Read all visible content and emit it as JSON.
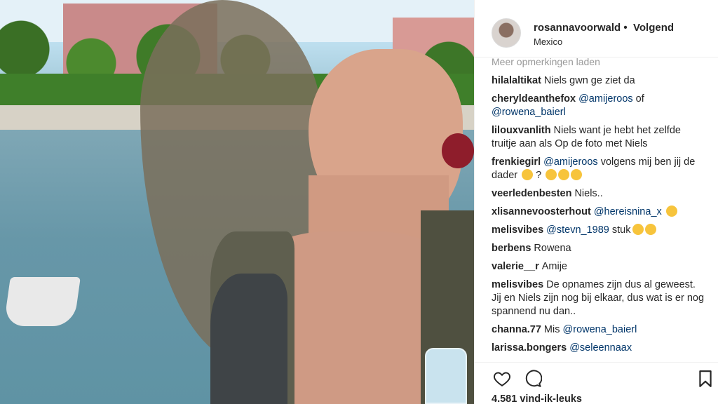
{
  "post": {
    "username": "rosannavoorwald",
    "separator": "•",
    "follow_label": "Volgend",
    "location": "Mexico"
  },
  "comments_more_label": "Meer opmerkingen laden",
  "comments": [
    {
      "user": "hilalaltikat",
      "text": "Niels gwn ge ziet da"
    },
    {
      "user": "cheryldeanthefox",
      "mention": "@amijeroos",
      "text_after": " of",
      "mention2": "@rowena_baierl"
    },
    {
      "user": "lilouxvanlith",
      "text": "Niels want je hebt het zelfde truitje aan als Op de foto met Niels"
    },
    {
      "user": "frenkiegirl",
      "mention": "@amijeroos",
      "text_after": " volgens mij ben jij de dader",
      "text_end": " ?"
    },
    {
      "user": "veerledenbesten",
      "text": "Niels.."
    },
    {
      "user": "xlisannevoosterhout",
      "mention": "@hereisnina_x"
    },
    {
      "user": "melisvibes",
      "mention": "@stevn_1989",
      "text_after": " stuk"
    },
    {
      "user": "berbens",
      "text": "Rowena"
    },
    {
      "user": "valerie__r",
      "text": "Amije"
    },
    {
      "user": "melisvibes",
      "text": "De opnames zijn dus al geweest. Jij en Niels zijn nog bij elkaar, dus wat is er nog spannend nu dan.."
    },
    {
      "user": "channa.77",
      "text": "Mis",
      "mention": "@rowena_baierl"
    },
    {
      "user": "larissa.bongers",
      "mention": "@seleennaax"
    }
  ],
  "actions": {
    "like_icon": "heart-icon",
    "comment_icon": "comment-icon",
    "save_icon": "bookmark-icon"
  },
  "likes_label": "4.581 vind-ik-leuks",
  "colors": {
    "mention": "#003569",
    "text": "#262626",
    "muted": "#999999",
    "divider": "#efefef"
  }
}
